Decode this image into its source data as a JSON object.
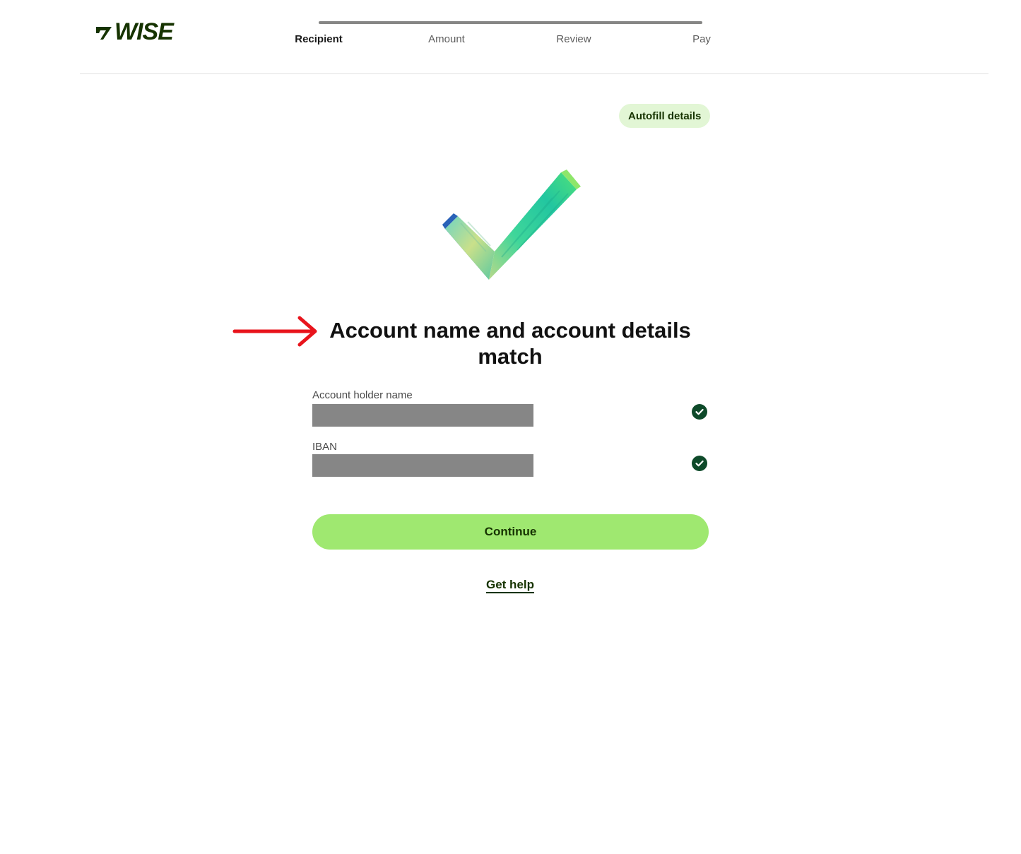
{
  "header": {
    "logo_text": "WISE",
    "steps": [
      {
        "label": "Recipient",
        "active": true
      },
      {
        "label": "Amount",
        "active": false
      },
      {
        "label": "Review",
        "active": false
      },
      {
        "label": "Pay",
        "active": false
      }
    ],
    "progress_fraction": 1.0
  },
  "autofill_label": "Autofill details",
  "illustration": "checkmark-illustration",
  "annotation": "red-arrow",
  "title": "Account name and account details match",
  "fields": [
    {
      "label": "Account holder name",
      "value_redacted": true,
      "status_icon": "check-circle-icon"
    },
    {
      "label": "IBAN",
      "value_redacted": true,
      "status_icon": "check-circle-icon"
    }
  ],
  "continue_label": "Continue",
  "help_label": "Get help",
  "colors": {
    "brand_dark": "#163300",
    "brand_green": "#9fe870",
    "chip_bg": "#e2f6d5",
    "check_bg": "#0e4a2a",
    "redaction": "#868686",
    "annotation_red": "#e8141c"
  }
}
